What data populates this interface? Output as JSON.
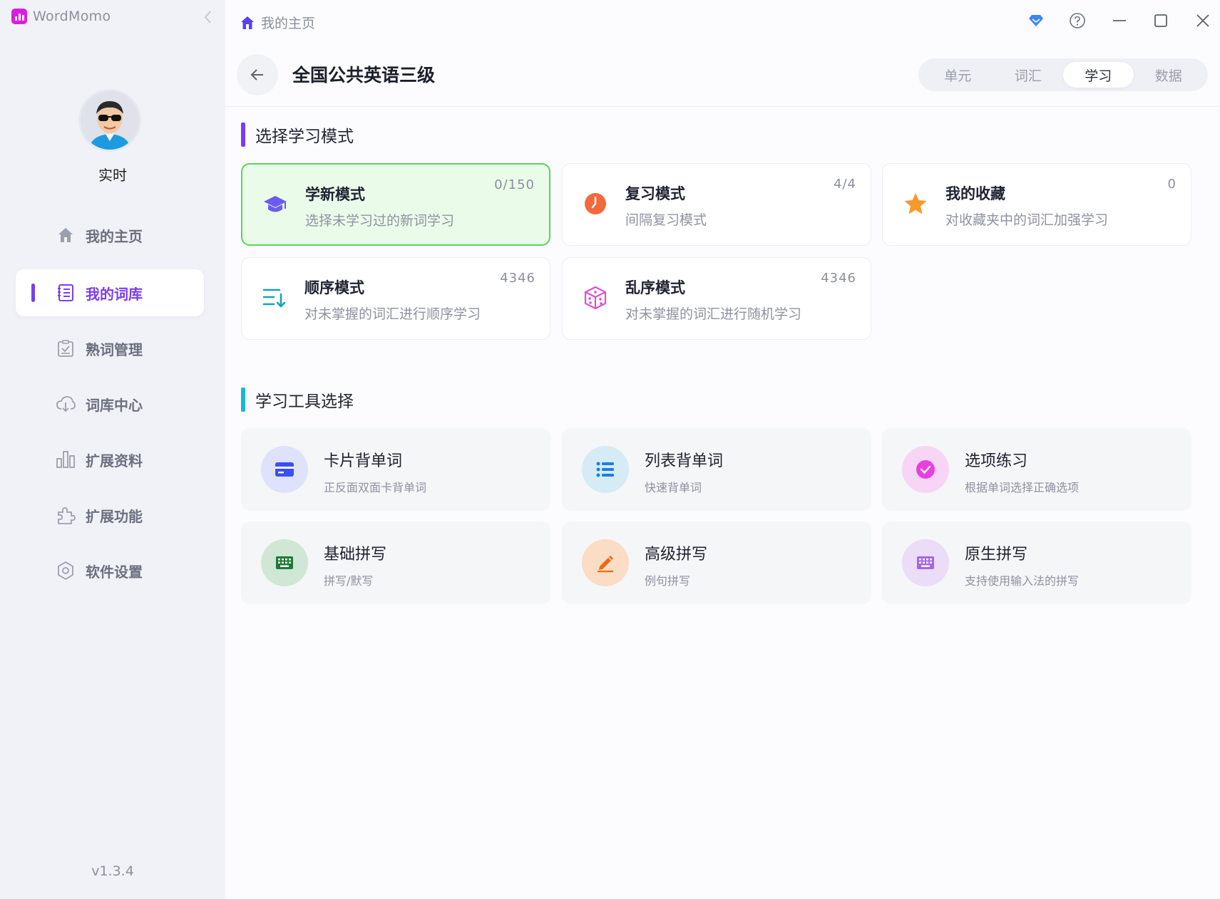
{
  "app": {
    "name": "WordMomo",
    "version": "v1.3.4",
    "accent": "#7b3df2"
  },
  "user": {
    "name": "实时"
  },
  "sidebar": {
    "items": [
      {
        "label": "我的主页",
        "icon": "home-icon",
        "active": false
      },
      {
        "label": "我的词库",
        "icon": "book-list-icon",
        "active": true
      },
      {
        "label": "熟词管理",
        "icon": "clipboard-check-icon",
        "active": false
      },
      {
        "label": "词库中心",
        "icon": "cloud-download-icon",
        "active": false
      },
      {
        "label": "扩展资料",
        "icon": "bar-chart-icon",
        "active": false
      },
      {
        "label": "扩展功能",
        "icon": "puzzle-icon",
        "active": false
      },
      {
        "label": "软件设置",
        "icon": "settings-hex-icon",
        "active": false
      }
    ]
  },
  "topbar": {
    "breadcrumb": "我的主页",
    "controls": [
      "vip-diamond-icon",
      "help-icon",
      "minimize-icon",
      "maximize-icon",
      "close-icon"
    ]
  },
  "header": {
    "title": "全国公共英语三级",
    "tabs": [
      {
        "label": "单元",
        "active": false
      },
      {
        "label": "词汇",
        "active": false
      },
      {
        "label": "学习",
        "active": true
      },
      {
        "label": "数据",
        "active": false
      }
    ]
  },
  "modes": {
    "section_title": "选择学习模式",
    "items": [
      {
        "title": "学新模式",
        "desc": "选择未学习过的新词学习",
        "count": "0/150",
        "icon": "graduation-cap-icon",
        "selected": true
      },
      {
        "title": "复习模式",
        "desc": "间隔复习模式",
        "count": "4/4",
        "icon": "clock-icon",
        "selected": false
      },
      {
        "title": "我的收藏",
        "desc": "对收藏夹中的词汇加强学习",
        "count": "0",
        "icon": "star-icon",
        "selected": false
      },
      {
        "title": "顺序模式",
        "desc": "对未掌握的词汇进行顺序学习",
        "count": "4346",
        "icon": "sort-order-icon",
        "selected": false
      },
      {
        "title": "乱序模式",
        "desc": "对未掌握的词汇进行随机学习",
        "count": "4346",
        "icon": "dice-icon",
        "selected": false
      }
    ]
  },
  "tools": {
    "section_title": "学习工具选择",
    "items": [
      {
        "title": "卡片背单词",
        "desc": "正反面双面卡背单词",
        "icon": "card-icon"
      },
      {
        "title": "列表背单词",
        "desc": "快速背单词",
        "icon": "list-icon"
      },
      {
        "title": "选项练习",
        "desc": "根据单词选择正确选项",
        "icon": "check-circle-icon"
      },
      {
        "title": "基础拼写",
        "desc": "拼写/默写",
        "icon": "keyboard-icon"
      },
      {
        "title": "高级拼写",
        "desc": "例句拼写",
        "icon": "pencil-icon"
      },
      {
        "title": "原生拼写",
        "desc": "支持使用输入法的拼写",
        "icon": "ime-keyboard-icon"
      }
    ]
  }
}
